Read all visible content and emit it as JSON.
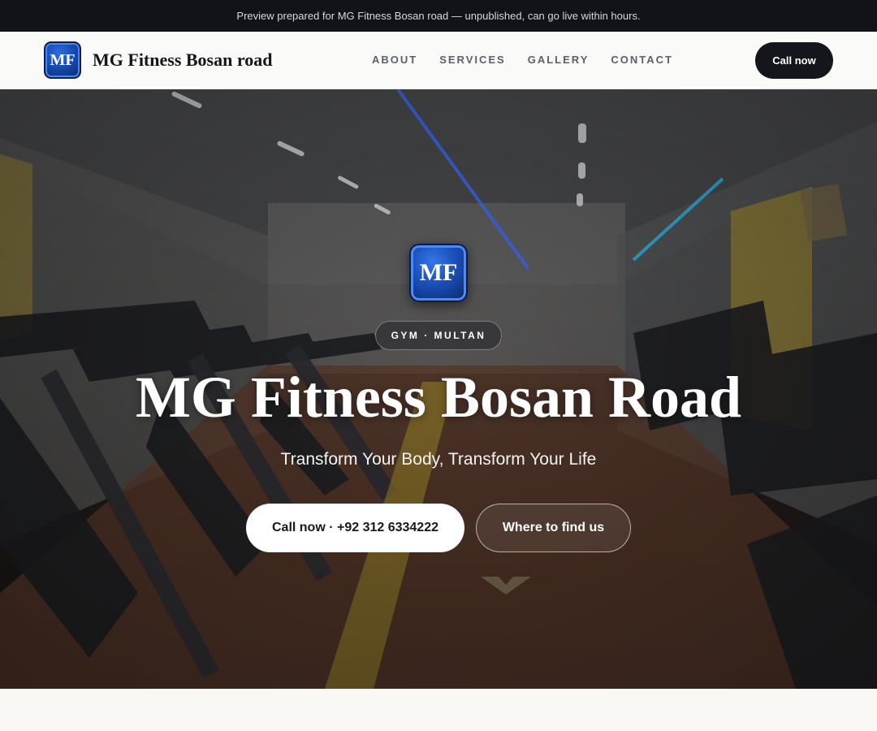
{
  "topbar": {
    "notice": "Preview prepared for MG Fitness Bosan road — unpublished, can go live within hours."
  },
  "navbar": {
    "logo_text": "MF",
    "brand_name": "MG Fitness Bosan road",
    "links": [
      {
        "label": "ABOUT"
      },
      {
        "label": "SERVICES"
      },
      {
        "label": "GALLERY"
      },
      {
        "label": "CONTACT"
      }
    ],
    "cta_label": "Call now"
  },
  "hero": {
    "logo_text": "MF",
    "badge": "GYM · MULTAN",
    "title": "MG Fitness Bosan Road",
    "subtitle": "Transform Your Body, Transform Your Life",
    "primary_button": "Call now · +92 312 6334222",
    "secondary_button": "Where to find us",
    "scroll_icon": "chevron-down-icon",
    "background_icon": "gym-interior-photo"
  },
  "colors": {
    "dark": "#111318",
    "logo_blue": "#1a4fb8",
    "page_bg": "#f9f8f4"
  }
}
